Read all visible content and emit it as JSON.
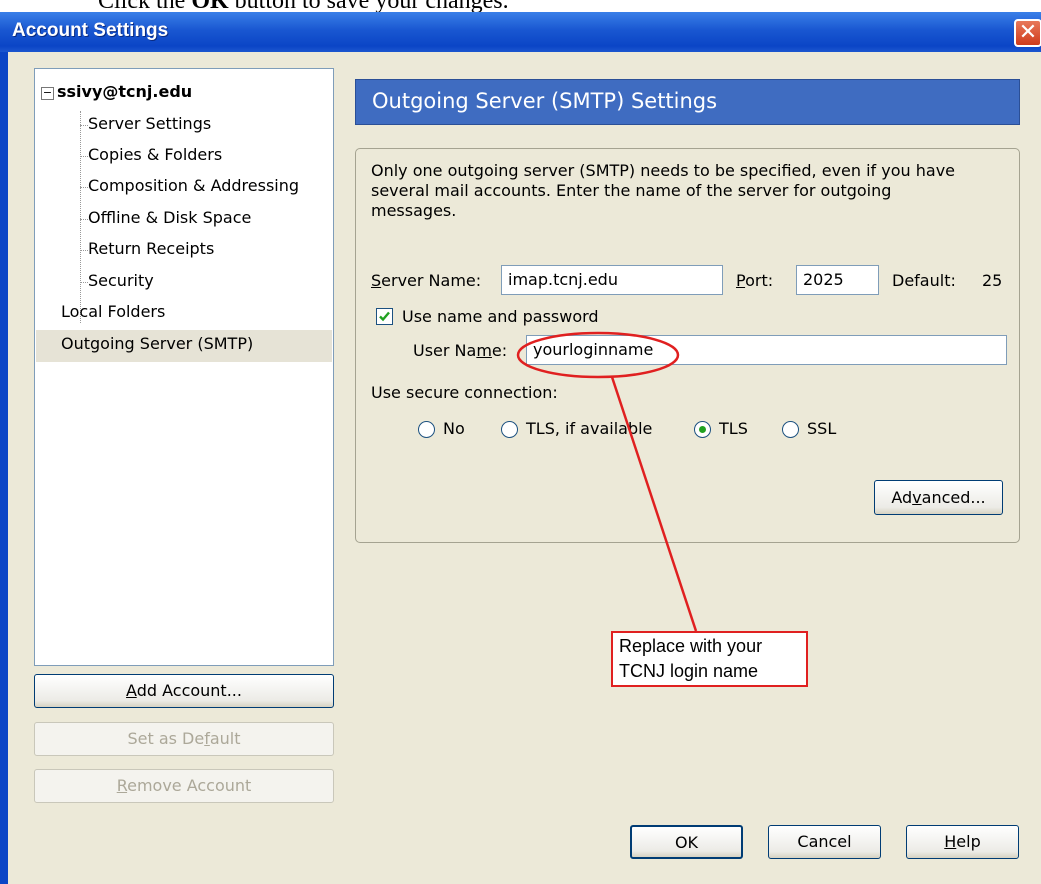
{
  "doc_line": {
    "prefix": "Click the ",
    "bold": "OK",
    "suffix": " button to save your changes."
  },
  "window": {
    "title": "Account Settings",
    "close_glyph": "✕"
  },
  "tree": {
    "root": {
      "expander": "−",
      "label": "ssivy@tcnj.edu"
    },
    "children": [
      "Server Settings",
      "Copies & Folders",
      "Composition & Addressing",
      "Offline & Disk Space",
      "Return Receipts",
      "Security"
    ],
    "local_folders": "Local Folders",
    "outgoing": "Outgoing Server (SMTP)"
  },
  "side_buttons": {
    "add_account": {
      "pre": "",
      "ul": "A",
      "post": "dd Account..."
    },
    "set_default": {
      "pre": "Set as De",
      "ul": "f",
      "post": "ault"
    },
    "remove_account": {
      "pre": "",
      "ul": "R",
      "post": "emove Account"
    }
  },
  "panel": {
    "header": "Outgoing Server (SMTP) Settings",
    "description_lines": [
      "Only one outgoing server (SMTP) needs to be specified, even if you have",
      "several mail accounts. Enter the name of the server for outgoing",
      "messages."
    ],
    "server_name": {
      "label_ul": "S",
      "label_rest": "erver Name:",
      "value": "imap.tcnj.edu"
    },
    "port": {
      "label_ul": "P",
      "label_rest": "ort:",
      "value": "2025"
    },
    "default": {
      "label": "Default:",
      "value": "25"
    },
    "use_name_password": {
      "label": "Use name and password",
      "checked": true
    },
    "user_name": {
      "label_pre": "User Na",
      "label_ul": "m",
      "label_post": "e:",
      "value": "yourloginname"
    },
    "secure": {
      "label": "Use secure connection:",
      "options": [
        {
          "label": "No",
          "selected": false
        },
        {
          "label": "TLS, if available",
          "selected": false
        },
        {
          "label": "TLS",
          "selected": true
        },
        {
          "label": "SSL",
          "selected": false
        }
      ]
    },
    "advanced": {
      "pre": "Ad",
      "ul": "v",
      "post": "anced..."
    }
  },
  "annotation": {
    "lines": [
      "Replace with your",
      "TCNJ login name"
    ],
    "color": "#e02020"
  },
  "footer": {
    "ok": "OK",
    "cancel": "Cancel",
    "help": {
      "ul": "H",
      "post": "elp"
    }
  },
  "colors": {
    "title_bar": "#0b45c6",
    "header_bg": "#3f6cc1",
    "dialog_bg": "#ece9d8"
  }
}
